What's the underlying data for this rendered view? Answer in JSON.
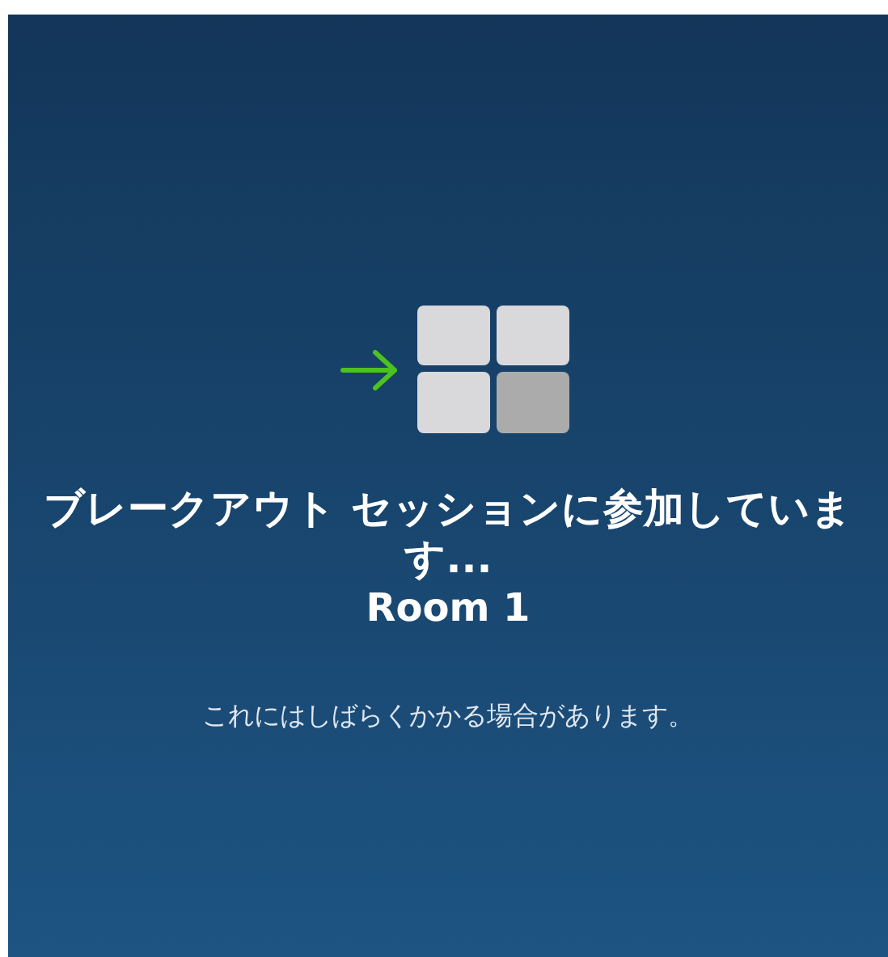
{
  "status": {
    "title": "ブレークアウト セッションに参加しています...",
    "room": "Room 1",
    "message": "これにはしばらくかかる場合があります。"
  }
}
